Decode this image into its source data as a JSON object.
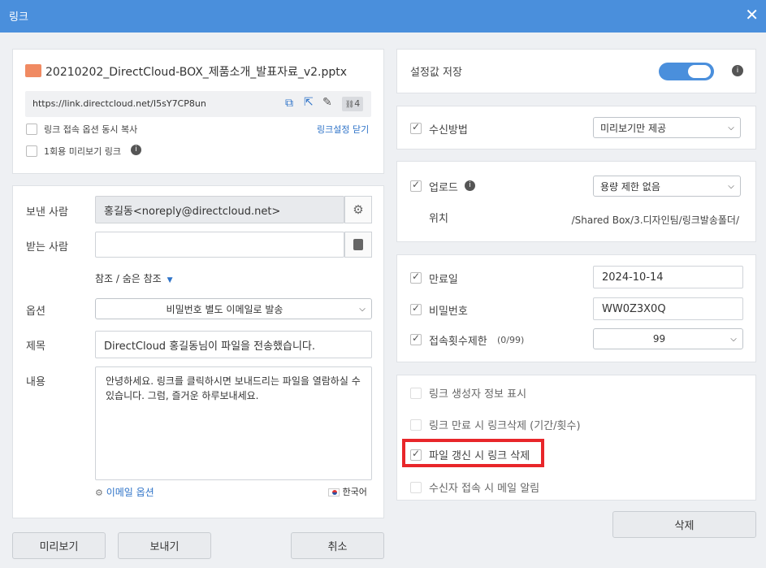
{
  "window": {
    "title": "링크"
  },
  "file": {
    "name": "20210202_DirectCloud-BOX_제품소개_발표자료_v2.pptx"
  },
  "link": {
    "url": "https://link.directcloud.net/I5sY7CP8un",
    "count": "4"
  },
  "options": {
    "copy_label": "링크 접속 옵션 동시 복사",
    "close_settings": "링크설정 닫기",
    "one_time_label": "1회용 미리보기 링크"
  },
  "email": {
    "sender_label": "보낸 사람",
    "sender_value": "홍길동<noreply@directcloud.net>",
    "recipient_label": "받는 사람",
    "recipient_value": "",
    "cc_label": "참조 / 숨은 참조",
    "option_label": "옵션",
    "option_value": "비밀번호 별도 이메일로 발송",
    "subject_label": "제목",
    "subject_value": "DirectCloud 홍길동님이 파일을 전송했습니다.",
    "body_label": "내용",
    "body_value": "안녕하세요. 링크를 클릭하시면 보내드리는 파일을 열람하실 수 있습니다. 그럼, 즐거운 하루보내세요.",
    "email_options": "이메일 옵션",
    "language": "한국어"
  },
  "buttons": {
    "preview": "미리보기",
    "send": "보내기",
    "cancel": "취소",
    "delete": "삭제"
  },
  "settings": {
    "save_label": "설정값 저장",
    "save_enabled": true,
    "receive_label": "수신방법",
    "receive_value": "미리보기만 제공",
    "upload_label": "업로드",
    "upload_value": "용량 제한 없음",
    "location_label": "위치",
    "location_value": "/Shared Box/3.디자인팀/링크발송폴더/",
    "expiry_label": "만료일",
    "expiry_value": "2024-10-14",
    "password_label": "비밀번호",
    "password_value": "WW0Z3X0Q",
    "access_limit_label": "접속횟수제한",
    "access_limit_note": "(0/99)",
    "access_limit_value": "99",
    "extra": [
      {
        "label": "링크 생성자 정보 표시",
        "checked": false
      },
      {
        "label": "링크 만료 시 링크삭제 (기간/횟수)",
        "checked": false
      },
      {
        "label": "파일 갱신 시 링크 삭제",
        "checked": true
      },
      {
        "label": "수신자 접속 시 메일 알림",
        "checked": false
      }
    ]
  },
  "colors": {
    "accent": "#4a8fdc",
    "highlight": "#e8262a"
  }
}
